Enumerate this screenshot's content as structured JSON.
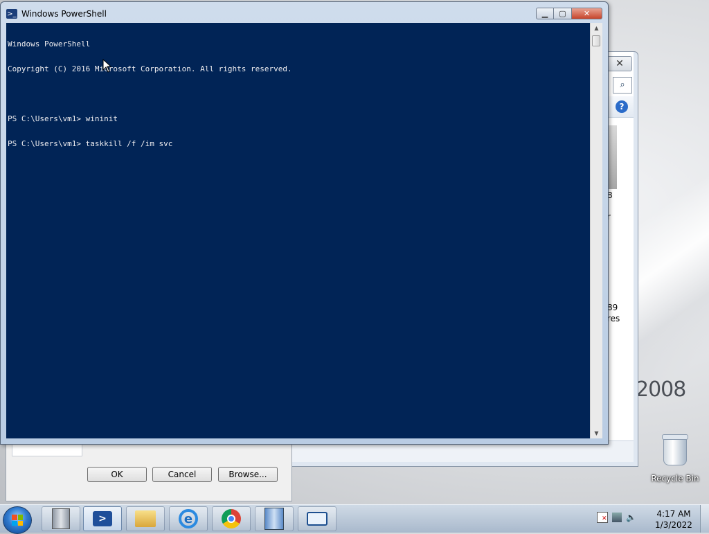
{
  "desktop": {
    "brand_text": "2008",
    "recycle_bin_label": "Recycle Bin"
  },
  "background_window": {
    "side_texts": [
      "8",
      "r",
      "89",
      "res"
    ]
  },
  "background_dialog": {
    "ok_label": "OK",
    "cancel_label": "Cancel",
    "browse_label": "Browse..."
  },
  "powershell": {
    "title": "Windows PowerShell",
    "console_lines": [
      "Windows PowerShell",
      "Copyright (C) 2016 Microsoft Corporation. All rights reserved.",
      "",
      "PS C:\\Users\\vm1> wininit",
      "PS C:\\Users\\vm1> taskkill /f /im svc"
    ]
  },
  "taskbar": {
    "items": [
      {
        "icon": "server-manager-icon",
        "active": false
      },
      {
        "icon": "powershell-icon",
        "active": true
      },
      {
        "icon": "file-explorer-icon",
        "active": false
      },
      {
        "icon": "internet-explorer-icon",
        "active": false
      },
      {
        "icon": "chrome-icon",
        "active": false
      },
      {
        "icon": "server-tool-icon",
        "active": false
      },
      {
        "icon": "remote-desktop-icon",
        "active": false
      }
    ],
    "clock_time": "4:17 AM",
    "clock_date": "1/3/2022"
  },
  "colors": {
    "console_bg": "#012456",
    "console_text": "#eeedf0",
    "close_button": "#c7442a"
  }
}
